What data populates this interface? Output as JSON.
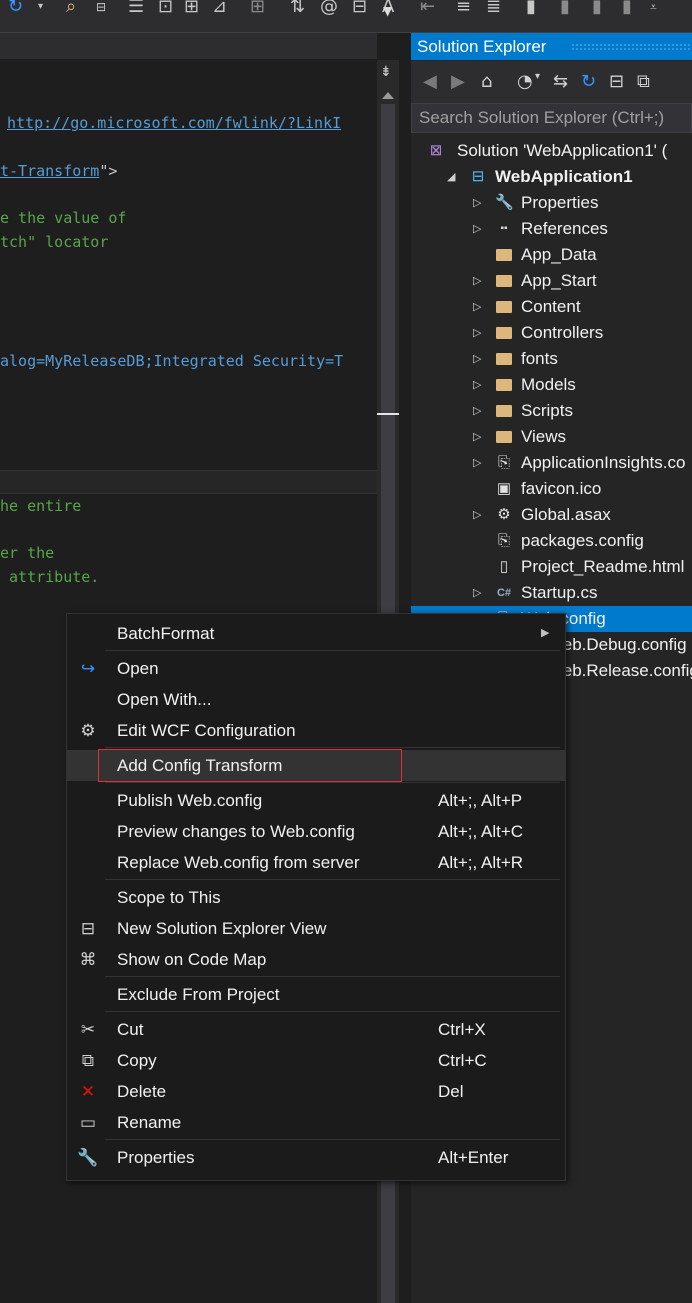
{
  "editor": {
    "code_lines": [
      {
        "parts": [
          {
            "text": "http://go.microsoft.com/fwlink/?LinkI",
            "cls": "c-link"
          }
        ]
      },
      {
        "parts": [
          {
            "text": "t-Transform",
            "cls": "c-link"
          },
          {
            "text": "\">",
            "cls": "c-punct"
          }
        ]
      },
      {
        "parts": [
          {
            "text": "e the value of",
            "cls": "c-comment"
          }
        ]
      },
      {
        "parts": [
          {
            "text": "tch\" locator",
            "cls": "c-comment"
          }
        ]
      },
      {
        "parts": [
          {
            "text": "alog=MyReleaseDB;Integrated Security=T",
            "cls": "c-str"
          }
        ]
      },
      {
        "parts": [
          {
            "text": "he entire",
            "cls": "c-comment"
          }
        ]
      },
      {
        "parts": [
          {
            "text": "er the",
            "cls": "c-comment"
          }
        ]
      },
      {
        "parts": [
          {
            "text": " attribute.",
            "cls": "c-comment"
          }
        ]
      }
    ]
  },
  "solution_explorer": {
    "title": "Solution Explorer",
    "search_placeholder": "Search Solution Explorer (Ctrl+;)",
    "items": [
      {
        "label": "Solution 'WebApplication1' (",
        "icon": "solution-icon",
        "level": 0,
        "expander": ""
      },
      {
        "label": "WebApplication1",
        "icon": "web-project-icon",
        "level": 1,
        "expander": "expanded",
        "bold": true
      },
      {
        "label": "Properties",
        "icon": "wrench-icon",
        "level": 2,
        "expander": "collapsed"
      },
      {
        "label": "References",
        "icon": "references-icon",
        "level": 2,
        "expander": "collapsed"
      },
      {
        "label": "App_Data",
        "icon": "folder-icon",
        "level": 2,
        "expander": ""
      },
      {
        "label": "App_Start",
        "icon": "folder-icon",
        "level": 2,
        "expander": "collapsed"
      },
      {
        "label": "Content",
        "icon": "folder-icon",
        "level": 2,
        "expander": "collapsed"
      },
      {
        "label": "Controllers",
        "icon": "folder-icon",
        "level": 2,
        "expander": "collapsed"
      },
      {
        "label": "fonts",
        "icon": "folder-icon",
        "level": 2,
        "expander": "collapsed"
      },
      {
        "label": "Models",
        "icon": "folder-icon",
        "level": 2,
        "expander": "collapsed"
      },
      {
        "label": "Scripts",
        "icon": "folder-icon",
        "level": 2,
        "expander": "collapsed"
      },
      {
        "label": "Views",
        "icon": "folder-icon",
        "level": 2,
        "expander": "collapsed"
      },
      {
        "label": "ApplicationInsights.co",
        "icon": "config-file-icon",
        "level": 2,
        "expander": "collapsed"
      },
      {
        "label": "favicon.ico",
        "icon": "image-file-icon",
        "level": 2,
        "expander": ""
      },
      {
        "label": "Global.asax",
        "icon": "asax-file-icon",
        "level": 2,
        "expander": "collapsed"
      },
      {
        "label": "packages.config",
        "icon": "config-file-icon",
        "level": 2,
        "expander": ""
      },
      {
        "label": "Project_Readme.html",
        "icon": "html-file-icon",
        "level": 2,
        "expander": ""
      },
      {
        "label": "Startup.cs",
        "icon": "csharp-file-icon",
        "level": 2,
        "expander": "collapsed"
      },
      {
        "label": "Web.config",
        "icon": "config-file-icon",
        "level": 2,
        "expander": "expanded",
        "selected": true
      },
      {
        "label": "Web.Debug.config",
        "icon": "config-file-icon",
        "level": 3,
        "expander": ""
      },
      {
        "label": "Web.Release.config",
        "icon": "config-file-icon",
        "level": 3,
        "expander": ""
      }
    ]
  },
  "context_menu": {
    "items": [
      {
        "label": "BatchFormat",
        "icon": "",
        "shortcut": "",
        "submenu": true
      },
      {
        "sep": true
      },
      {
        "label": "Open",
        "icon": "open-arrow-icon",
        "shortcut": ""
      },
      {
        "label": "Open With...",
        "icon": "",
        "shortcut": ""
      },
      {
        "label": "Edit WCF Configuration",
        "icon": "wcf-config-icon",
        "shortcut": ""
      },
      {
        "sep": true
      },
      {
        "label": "Add Config Transform",
        "icon": "",
        "shortcut": "",
        "highlighted": true
      },
      {
        "sep": true
      },
      {
        "label": "Publish Web.config",
        "icon": "",
        "shortcut": "Alt+;, Alt+P"
      },
      {
        "label": "Preview changes to Web.config",
        "icon": "",
        "shortcut": "Alt+;, Alt+C"
      },
      {
        "label": "Replace Web.config from server",
        "icon": "",
        "shortcut": "Alt+;, Alt+R"
      },
      {
        "sep": true
      },
      {
        "label": "Scope to This",
        "icon": "",
        "shortcut": ""
      },
      {
        "label": "New Solution Explorer View",
        "icon": "new-view-icon",
        "shortcut": ""
      },
      {
        "label": "Show on Code Map",
        "icon": "code-map-icon",
        "shortcut": ""
      },
      {
        "sep": true
      },
      {
        "label": "Exclude From Project",
        "icon": "",
        "shortcut": ""
      },
      {
        "sep": true
      },
      {
        "label": "Cut",
        "icon": "scissors-icon",
        "shortcut": "Ctrl+X"
      },
      {
        "label": "Copy",
        "icon": "copy-icon",
        "shortcut": "Ctrl+C"
      },
      {
        "label": "Delete",
        "icon": "delete-x-icon",
        "shortcut": "Del"
      },
      {
        "label": "Rename",
        "icon": "rename-icon",
        "shortcut": ""
      },
      {
        "sep": true
      },
      {
        "label": "Properties",
        "icon": "wrench-icon",
        "shortcut": "Alt+Enter"
      }
    ]
  },
  "colors": {
    "accent": "#007acc",
    "highlight_box": "#e03131",
    "delete_icon": "#e51400",
    "open_icon": "#3794ff"
  }
}
